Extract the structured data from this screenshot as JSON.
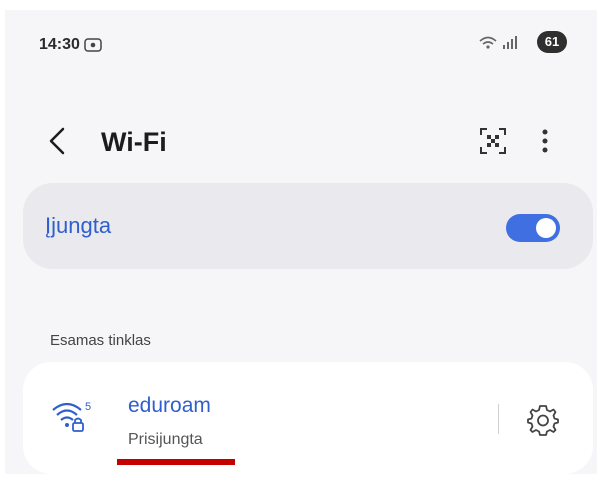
{
  "status_bar": {
    "time": "14:30",
    "battery": "61"
  },
  "app_bar": {
    "title": "Wi-Fi"
  },
  "wifi_toggle": {
    "label": "Įjungta",
    "enabled": true,
    "accent_color": "#3f6fe1"
  },
  "current_network": {
    "section_title": "Esamas tinklas",
    "name": "eduroam",
    "status": "Prisijungta",
    "band": "5",
    "icons": [
      "wifi-secure-icon",
      "gear-icon"
    ]
  },
  "colors": {
    "accent_text": "#2f5fce",
    "background": "#f6f6f8",
    "highlight_underline": "#c40000"
  }
}
